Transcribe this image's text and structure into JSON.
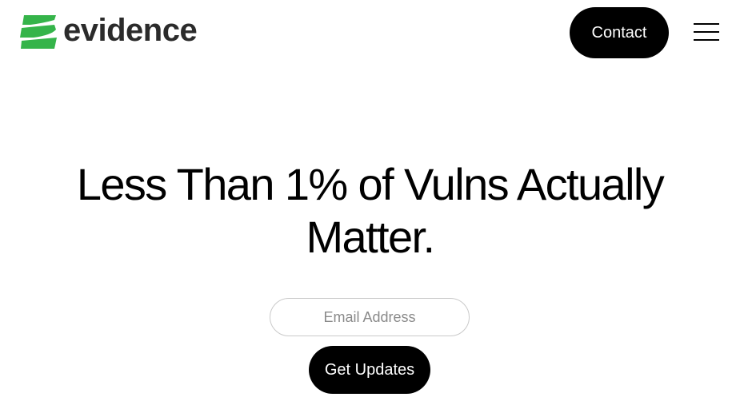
{
  "header": {
    "logo": {
      "text": "evidence",
      "icon": "evidence-wave-logo-icon",
      "mark_color": "#35b44a",
      "text_color": "#2b2b2b"
    },
    "contact_label": "Contact",
    "menu_icon": "hamburger-menu-icon"
  },
  "hero": {
    "title": "Less Than 1% of Vulns Actually Matter."
  },
  "signup": {
    "email_placeholder": "Email Address",
    "email_value": "",
    "submit_label": "Get Updates"
  },
  "colors": {
    "background": "#ffffff",
    "button_bg": "#000000",
    "button_text": "#ffffff",
    "brand_green": "#35b44a"
  }
}
